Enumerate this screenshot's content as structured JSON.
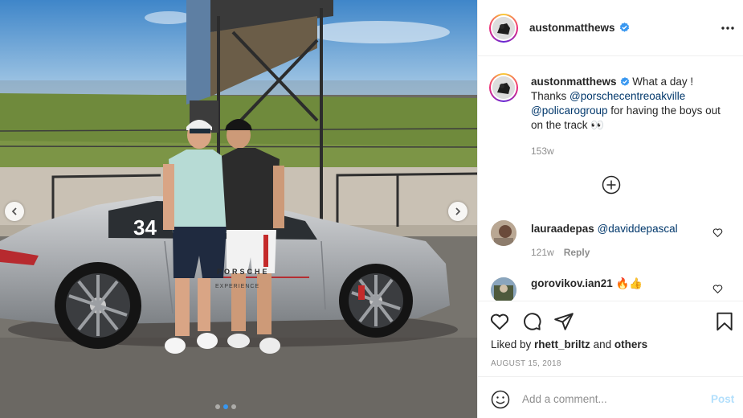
{
  "photo": {
    "car_number": "34",
    "car_door_text": "PORSCHE",
    "car_door_subtext": "EXPERIENCE",
    "slide_count": 3,
    "active_slide": 2
  },
  "post": {
    "author": "austonmatthews",
    "verified": true,
    "caption": {
      "author": "austonmatthews",
      "text_1": "What a day ! Thanks ",
      "mention_1": "@porschecentreoakville",
      "mention_2": "@policarogroup",
      "text_2": " for having the boys out on the track",
      "emoji": "👀",
      "time": "153w"
    },
    "comments": [
      {
        "user": "lauraadepas",
        "text": "@daviddepascal",
        "time": "121w",
        "reply_label": "Reply"
      },
      {
        "user": "gorovikov.ian21",
        "text": "🔥👍"
      }
    ],
    "liked_by_prefix": "Liked by ",
    "liked_by_user": "rhett_briltz",
    "liked_by_mid": " and ",
    "liked_by_others": "others",
    "date": "August 15, 2018"
  },
  "comment_box": {
    "placeholder": "Add a comment...",
    "post_label": "Post"
  },
  "icons": {
    "more": "more-options-icon",
    "load_more": "plus-circle-icon",
    "like": "heart-icon",
    "comment": "comment-icon",
    "share": "share-icon",
    "save": "bookmark-icon",
    "emoji": "emoji-icon"
  },
  "colors": {
    "accent": "#3897f0",
    "link": "#00376b",
    "muted": "#8e8e8e",
    "post_disabled": "#b2dffc",
    "verified": "#3897f0"
  }
}
